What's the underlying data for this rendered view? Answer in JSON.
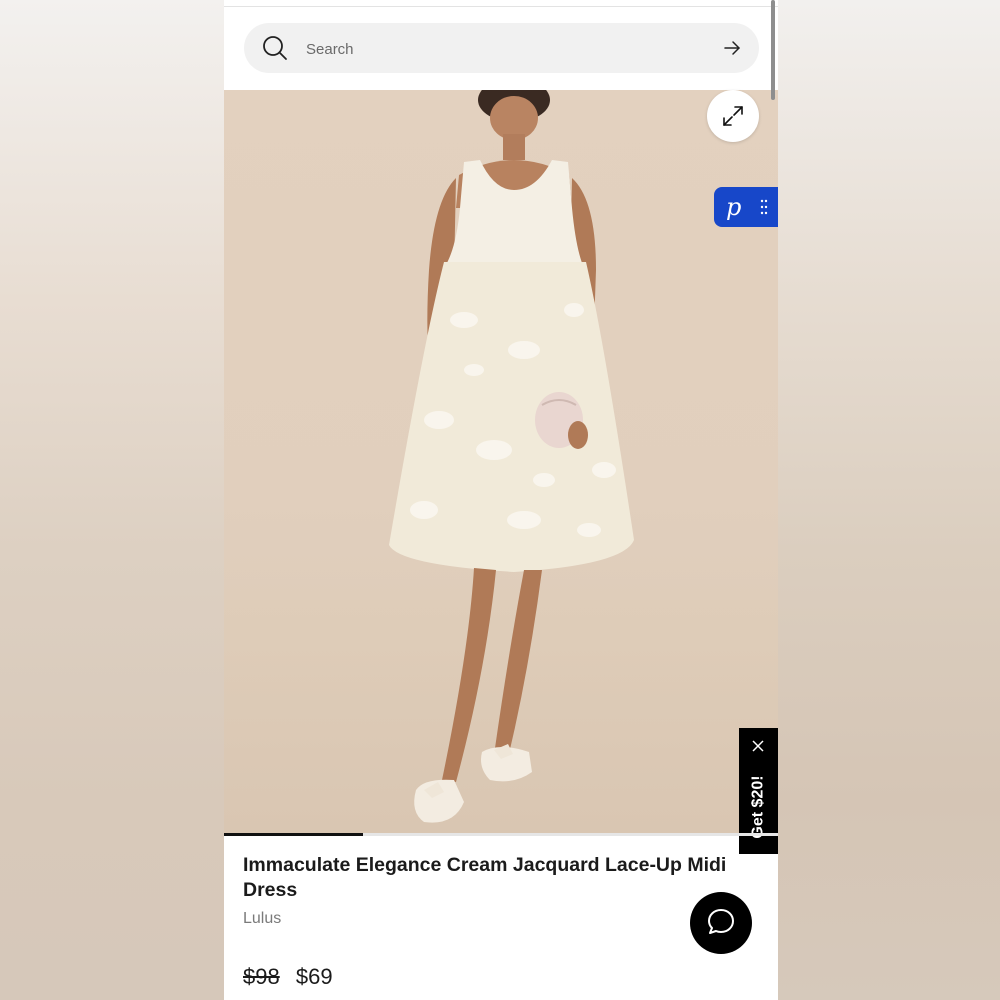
{
  "search": {
    "placeholder": "Search",
    "icon": "search-icon",
    "submit_icon": "arrow-right-icon"
  },
  "gallery": {
    "image_alt": "Immaculate Elegance Cream Jacquard Lace-Up Midi Dress",
    "expand_icon": "expand-icon",
    "progress": 0.25
  },
  "widget": {
    "letter": "p",
    "icon": "grip-icon",
    "color": "#1747c9"
  },
  "promo": {
    "label": "Get $20!",
    "close_icon": "close-icon"
  },
  "product": {
    "title": "Immaculate Elegance Cream Jacquard Lace-Up Midi Dress",
    "brand": "Lulus",
    "original_price": "$98",
    "sale_price": "$69"
  },
  "chat": {
    "icon": "chat-icon"
  }
}
